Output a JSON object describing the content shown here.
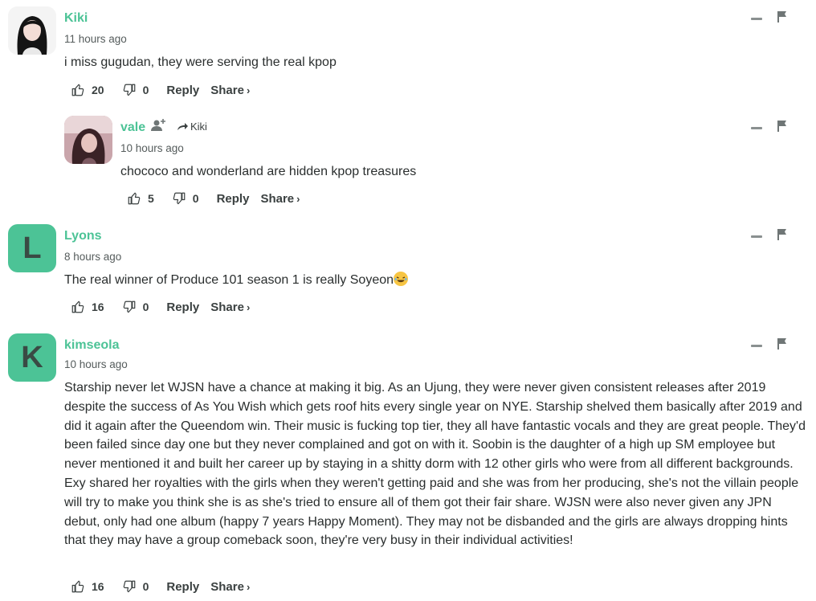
{
  "comments": [
    {
      "author": "Kiki",
      "time": "11 hours ago",
      "text": "i miss gugudan, they were serving the real kpop",
      "upvotes": "20",
      "downvotes": "0",
      "reply_label": "Reply",
      "share_label": "Share",
      "share_chevron": "›"
    },
    {
      "author": "vale",
      "reply_to": "Kiki",
      "time": "10 hours ago",
      "text": "chococo and wonderland are hidden kpop treasures",
      "upvotes": "5",
      "downvotes": "0",
      "reply_label": "Reply",
      "share_label": "Share",
      "share_chevron": "›"
    },
    {
      "author": "Lyons",
      "avatar_letter": "L",
      "time": "8 hours ago",
      "text": "The real winner of Produce 101 season 1 is really Soyeon",
      "upvotes": "16",
      "downvotes": "0",
      "reply_label": "Reply",
      "share_label": "Share",
      "share_chevron": "›"
    },
    {
      "author": "kimseola",
      "avatar_letter": "K",
      "time": "10 hours ago",
      "text": "Starship never let WJSN have a chance at making it big. As an Ujung, they were never given consistent releases after 2019 despite the success of As You Wish which gets roof hits every single year on NYE. Starship shelved them basically after 2019 and did it again after the Queendom win. Their music is fucking top tier, they all have fantastic vocals and they are great people. They'd been failed since day one but they never complained and got on with it. Soobin is the daughter of a high up SM employee but never mentioned it and built her career up by staying in a shitty dorm with 12 other girls who were from all different backgrounds. Exy shared her royalties with the girls when they weren't getting paid and she was from her producing, she's not the villain people will try to make you think she is as she's tried to ensure all of them got their fair share. WJSN were also never given any JPN debut, only had one album (happy 7 years Happy Moment). They may not be disbanded and the girls are always dropping hints that they may have a group comeback soon, they're very busy in their individual activities!",
      "upvotes": "16",
      "downvotes": "0",
      "reply_label": "Reply",
      "share_label": "Share",
      "share_chevron": "›"
    }
  ],
  "colors": {
    "accent": "#4cc396",
    "text": "#2a2e2e",
    "muted": "#555c5c"
  }
}
